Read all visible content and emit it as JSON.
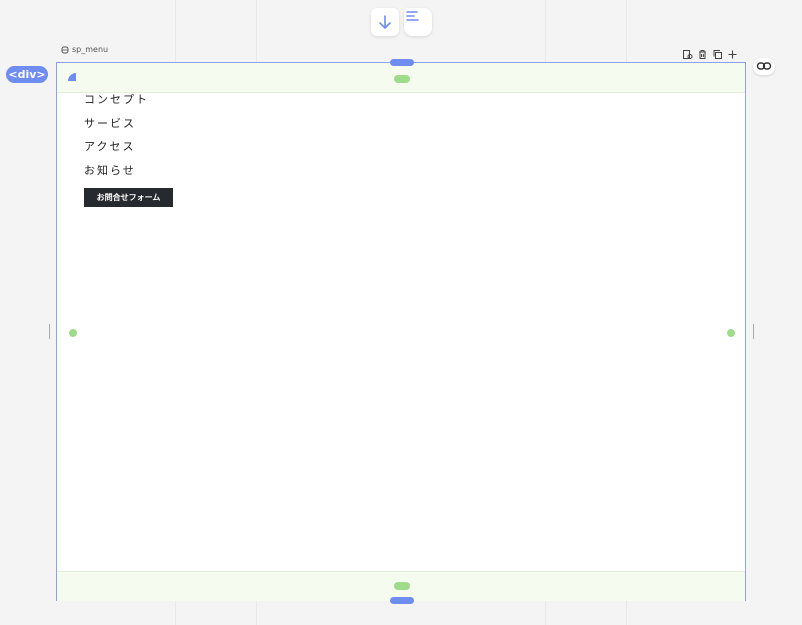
{
  "component_label": "sp_menu",
  "element_tag": "<div>",
  "menu_items": [
    "コンセプト",
    "サービス",
    "アクセス",
    "お知らせ"
  ],
  "cta_button_label": "お問合せフォーム",
  "colors": {
    "accent": "#6f8cf0",
    "padding_overlay": "#f5fbef",
    "padding_handle": "#9edc8a",
    "cta_background": "#26292d"
  },
  "icons": {
    "top_toolbar": [
      "arrow-down-icon",
      "align-left-icon"
    ],
    "component": "component-icon",
    "tools": [
      "duplicate-page-icon",
      "trash-icon",
      "copy-icon",
      "plus-icon"
    ],
    "link": "link-icon"
  }
}
